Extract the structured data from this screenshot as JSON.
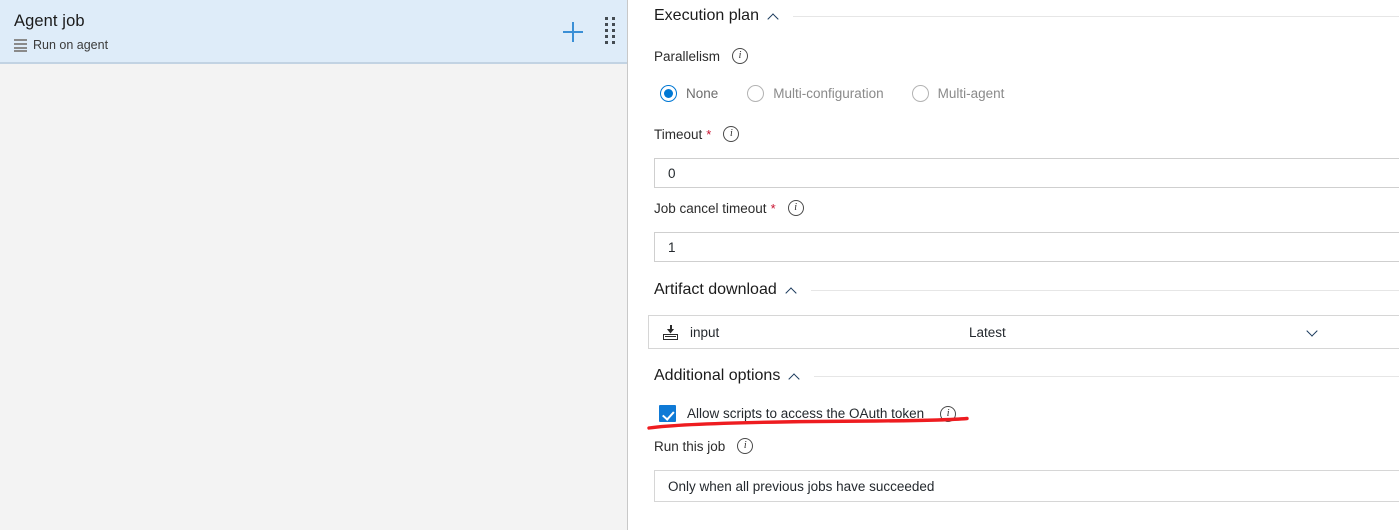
{
  "left_panel": {
    "job_title": "Agent job",
    "job_subtitle": "Run on agent",
    "server_icon": "server-icon",
    "add_icon": "plus-icon",
    "drag_icon": "drag-handle-icon"
  },
  "right_panel": {
    "sections": {
      "execution_plan": {
        "title": "Execution plan",
        "collapse_icon": "chevron-up-icon"
      },
      "artifact_download": {
        "title": "Artifact download",
        "collapse_icon": "chevron-up-icon"
      },
      "additional_options": {
        "title": "Additional options",
        "collapse_icon": "chevron-up-icon"
      }
    },
    "parallelism": {
      "label": "Parallelism",
      "info_icon": "info-icon",
      "options": [
        {
          "label": "None",
          "checked": true
        },
        {
          "label": "Multi-configuration",
          "checked": false
        },
        {
          "label": "Multi-agent",
          "checked": false
        }
      ]
    },
    "timeout": {
      "label": "Timeout",
      "required_marker": "*",
      "info_icon": "info-icon",
      "value": "0"
    },
    "job_cancel_timeout": {
      "label": "Job cancel timeout",
      "required_marker": "*",
      "info_icon": "info-icon",
      "value": "1"
    },
    "artifact": {
      "icon": "artifact-download-icon",
      "name": "input",
      "version": "Latest",
      "chevron_icon": "chevron-down-icon"
    },
    "allow_oauth": {
      "label": "Allow scripts to access the OAuth token",
      "checked": true,
      "info_icon": "info-icon",
      "checkbox_color": "#0f7ad6"
    },
    "run_this_job": {
      "label": "Run this job",
      "info_icon": "info-icon",
      "selected_option": "Only when all previous jobs have succeeded"
    }
  },
  "annotation": {
    "type": "red-underline",
    "color": "#ee1c20"
  }
}
